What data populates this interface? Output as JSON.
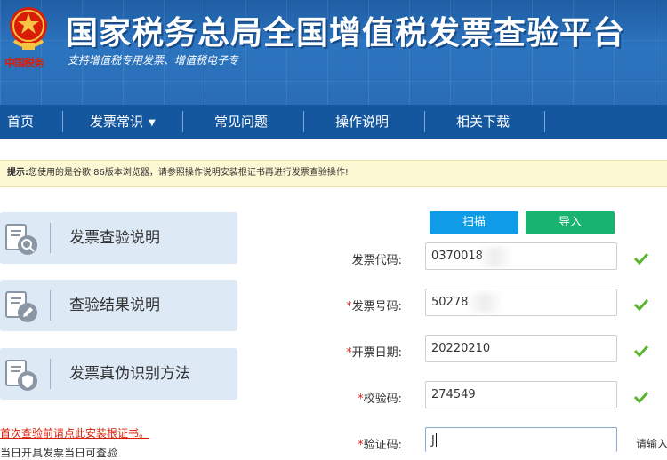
{
  "header": {
    "title": "国家税务总局全国增值税发票查验平台",
    "subtitle": "支持增值税专用发票、增值税电子专",
    "brand": "中国税务"
  },
  "nav": {
    "items": [
      {
        "label": "首页"
      },
      {
        "label": "发票常识"
      },
      {
        "label": "常见问题"
      },
      {
        "label": "操作说明"
      },
      {
        "label": "相关下载"
      }
    ],
    "dropdown_icon": "chevron-down-icon"
  },
  "notice": {
    "prefix": "提示:",
    "text": "您使用的是谷歌 86版本浏览器，请参照操作说明安装根证书再进行发票查验操作!"
  },
  "side": {
    "cards": [
      {
        "label": "发票查验说明",
        "icon": "document-search-icon"
      },
      {
        "label": "查验结果说明",
        "icon": "document-edit-icon"
      },
      {
        "label": "发票真伪识别方法",
        "icon": "document-shield-icon"
      }
    ],
    "cert_link": "首次查验前请点此安装根证书。",
    "cut_text": "当日开具发票当日可查验"
  },
  "form": {
    "scan_label": "扫描",
    "import_label": "导入",
    "fields": [
      {
        "label": "发票代码:",
        "required": false,
        "value": "0370018"
      },
      {
        "label": "发票号码:",
        "required": true,
        "value": "50278"
      },
      {
        "label": "开票日期:",
        "required": true,
        "value": "20220210"
      },
      {
        "label": "校验码:",
        "required": true,
        "value": "274549"
      },
      {
        "label": "验证码:",
        "required": true,
        "value": "J"
      }
    ],
    "captcha_hint": "请输入",
    "required_mark": "*"
  },
  "colors": {
    "header_blue": "#2a6db6",
    "nav_blue": "#14579e",
    "scan_button": "#0f9be5",
    "import_button": "#19b370",
    "check_green": "#5cb531",
    "required_red": "#e02020"
  }
}
